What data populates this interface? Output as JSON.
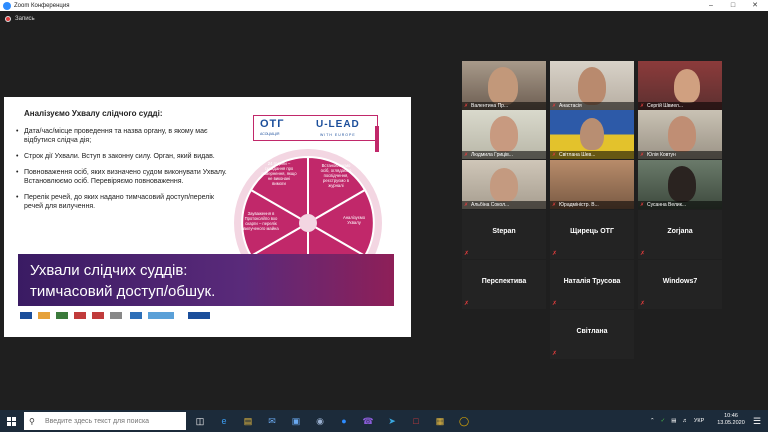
{
  "window": {
    "title": "Zoom Конференция",
    "controls": [
      "minimize-icon",
      "maximize-icon",
      "close-icon"
    ]
  },
  "recording": {
    "label": "Запись",
    "color": "#e03c3c"
  },
  "slide": {
    "title": "Аналізуємо Ухвалу слідчого судді:",
    "bullets": [
      "Дата/час/місце проведення та назва органу, в якому має відбутися слідча дія;",
      "Строк дії Ухвали. Вступ в законну силу. Орган, який видав.",
      "Повноваження осіб, яких визначено судом виконувати Ухвалу. Встановлюємо осіб. Перевіряємо повноваження.",
      "Перелік речей, до яких надано тимчасовий доступ/перелік речей для вилучення."
    ],
    "logo": {
      "otg": "ОТГ",
      "assoc": "АСОЦІАЦІЯ",
      "ulead": "U-LEAD",
      "ulead_sub": "WITH EUROPE"
    },
    "cycle": [
      "Встановлюємо осіб, оглядаємо посвідчення, реєструємо в журналі",
      "Аналізуємо Ухвалу",
      "Визначаємо одну концепцію/місце",
      "Відео/фото фіксація",
      "Зауваження в Протоколі/по вхо скарги – перелік вилученого майна",
      "24 години – складання про повернення, якщо не виконані вимоги"
    ],
    "banner_line1": "Ухвали слідчих суддів:",
    "banner_line2": "тимчасовий доступ/обшук.",
    "accent": "#c1286a"
  },
  "participants": [
    {
      "name": "Валентина Пр...",
      "muted": true,
      "video": true
    },
    {
      "name": "Анастасія",
      "muted": true,
      "video": true
    },
    {
      "name": "Сергій Швиел...",
      "muted": true,
      "video": true
    },
    {
      "name": "Людмила Гриців...",
      "muted": true,
      "video": true,
      "active": true
    },
    {
      "name": "Світлана Шев...",
      "muted": true,
      "video": true
    },
    {
      "name": "Юлія Ковтун",
      "muted": true,
      "video": true
    },
    {
      "name": "Альбіна Сокол...",
      "muted": true,
      "video": true
    },
    {
      "name": "Юрадміністр. В...",
      "muted": true,
      "video": true
    },
    {
      "name": "Сусанна Велик...",
      "muted": true,
      "video": true
    },
    {
      "name": "Stepan",
      "muted": true,
      "video": false
    },
    {
      "name": "Щирець ОТГ",
      "muted": true,
      "video": false
    },
    {
      "name": "Zorjana",
      "muted": true,
      "video": false
    },
    {
      "name": "Перспектива",
      "muted": true,
      "video": false
    },
    {
      "name": "Наталія Трусова",
      "muted": true,
      "video": false
    },
    {
      "name": "Windows7",
      "muted": true,
      "video": false
    },
    {
      "name": "Світлана",
      "muted": true,
      "video": false
    }
  ],
  "taskbar": {
    "search_placeholder": "Введите здесь текст для поиска",
    "apps": [
      "task-view-icon",
      "edge-icon",
      "file-explorer-icon",
      "mail-icon",
      "store-icon",
      "zoom-icon",
      "viber-icon",
      "telegram-icon",
      "acrobat-icon",
      "folder-icon",
      "chrome-icon"
    ],
    "tray_lang": "УКР",
    "time": "10:46",
    "date": "13.05.2020"
  }
}
